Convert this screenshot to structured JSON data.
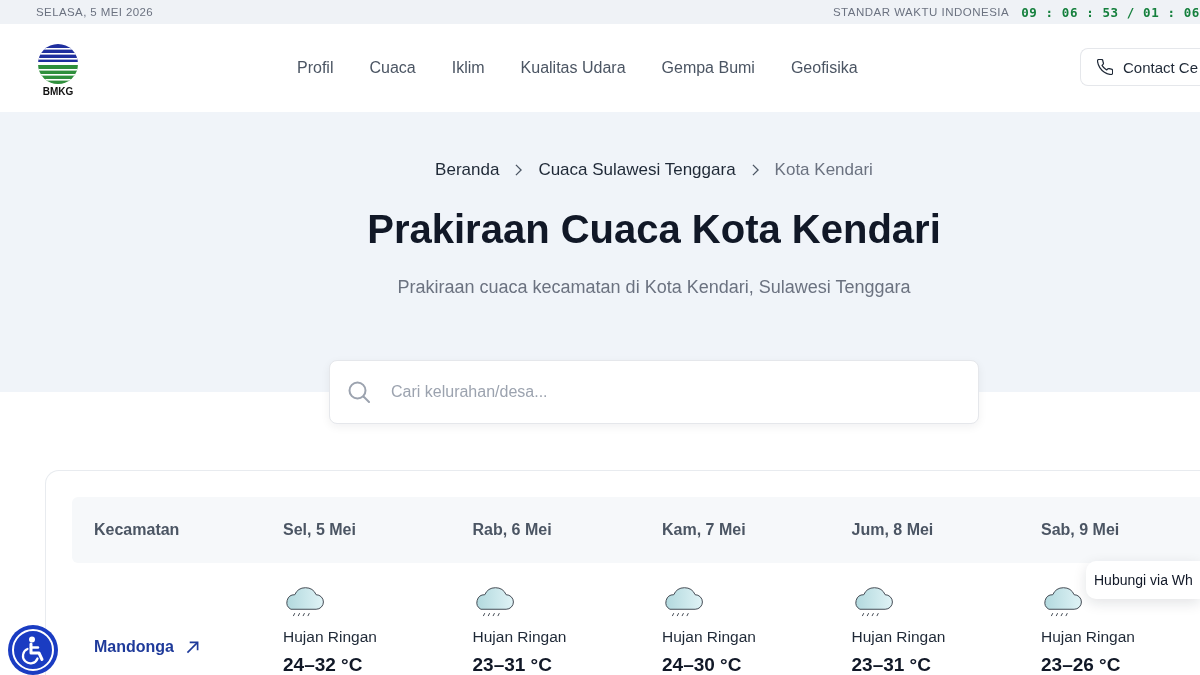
{
  "top_bar": {
    "date": "SELASA, 5 MEI 2026",
    "time_label": "STANDAR WAKTU INDONESIA",
    "clock": "09 : 06 : 53 / 01 : 06"
  },
  "header": {
    "logo_text": "BMKG",
    "nav": [
      "Profil",
      "Cuaca",
      "Iklim",
      "Kualitas Udara",
      "Gempa Bumi",
      "Geofisika"
    ],
    "contact_button": {
      "label": "Contact Ce"
    }
  },
  "hero": {
    "breadcrumb": [
      {
        "label": "Beranda",
        "current": false
      },
      {
        "label": "Cuaca Sulawesi Tenggara",
        "current": false
      },
      {
        "label": "Kota Kendari",
        "current": true
      }
    ],
    "title": "Prakiraan Cuaca Kota Kendari",
    "subtitle": "Prakiraan cuaca kecamatan di Kota Kendari, Sulawesi Tenggara",
    "search": {
      "placeholder": "Cari kelurahan/desa..."
    }
  },
  "table": {
    "columns": [
      "Kecamatan",
      "Sel, 5 Mei",
      "Rab, 6 Mei",
      "Kam, 7 Mei",
      "Jum, 8 Mei",
      "Sab, 9 Mei"
    ],
    "rows": [
      {
        "cells": [
          {
            "kind": "district",
            "label": "Mandonga"
          },
          {
            "kind": "light-rain",
            "condition": "Hujan Ringan",
            "temperature": "24–32 °C"
          },
          {
            "kind": "light-rain",
            "condition": "Hujan Ringan",
            "temperature": "23–31 °C"
          },
          {
            "kind": "light-rain",
            "condition": "Hujan Ringan",
            "temperature": "24–30 °C"
          },
          {
            "kind": "light-rain",
            "condition": "Hujan Ringan",
            "temperature": "23–31 °C"
          },
          {
            "kind": "light-rain",
            "condition": "Hujan Ringan",
            "temperature": "23–26 °C"
          }
        ]
      }
    ]
  },
  "whatsapp_tooltip": {
    "label": "Hubungi via Wh"
  }
}
